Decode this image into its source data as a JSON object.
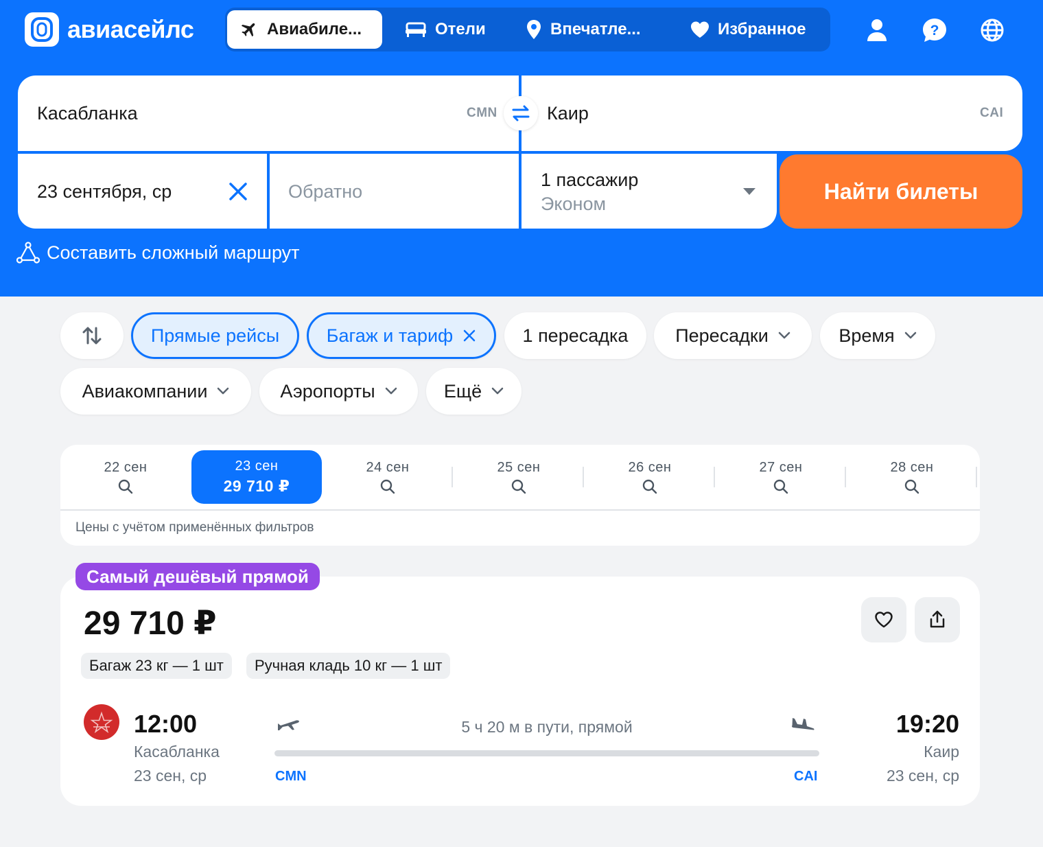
{
  "header": {
    "logo_text": "авиасейлс",
    "tabs": [
      {
        "label": "Авиабиле...",
        "icon": "plane-icon",
        "active": true
      },
      {
        "label": "Отели",
        "icon": "bed-icon",
        "active": false
      },
      {
        "label": "Впечатле...",
        "icon": "location-pin-icon",
        "active": false
      },
      {
        "label": "Избранное",
        "icon": "heart-icon",
        "active": false
      }
    ],
    "actions": [
      "user-icon",
      "help-icon",
      "globe-icon"
    ]
  },
  "search": {
    "origin": "Касабланка",
    "origin_code": "CMN",
    "destination": "Каир",
    "destination_code": "CAI",
    "depart_date": "23 сентября, ср",
    "return_placeholder": "Обратно",
    "passengers": "1 пассажир",
    "cabin_class": "Эконом",
    "search_button": "Найти билеты",
    "complex_route": "Составить сложный маршрут"
  },
  "filters": {
    "chips": [
      {
        "label": "Прямые рейсы",
        "selected": true
      },
      {
        "label": "Багаж и тариф",
        "selected": true,
        "removable": true
      },
      {
        "label": "1 пересадка",
        "selected": false
      },
      {
        "label": "Пересадки",
        "selected": false,
        "dropdown": true
      },
      {
        "label": "Время",
        "selected": false,
        "dropdown": true
      },
      {
        "label": "Авиакомпании",
        "selected": false,
        "dropdown": true
      },
      {
        "label": "Аэропорты",
        "selected": false,
        "dropdown": true
      },
      {
        "label": "Ещё",
        "selected": false,
        "dropdown": true
      }
    ]
  },
  "dates": {
    "days": [
      {
        "label": "22 сен",
        "price": null
      },
      {
        "label": "23 сен",
        "price": "29 710 ₽",
        "selected": true
      },
      {
        "label": "24 сен",
        "price": null
      },
      {
        "label": "25 сен",
        "price": null
      },
      {
        "label": "26 сен",
        "price": null
      },
      {
        "label": "27 сен",
        "price": null
      },
      {
        "label": "28 сен",
        "price": null
      }
    ],
    "note": "Цены с учётом применённых фильтров"
  },
  "ticket": {
    "badge": "Самый дешёвый прямой",
    "price": "29 710 ₽",
    "baggage": "Багаж 23 кг — 1 шт",
    "hand_luggage": "Ручная кладь 10 кг — 1 шт",
    "depart_time": "12:00",
    "depart_city": "Касабланка",
    "depart_date": "23 сен, ср",
    "arrive_time": "19:20",
    "arrive_city": "Каир",
    "arrive_date": "23 сен, ср",
    "duration": "5 ч 20 м в пути, прямой",
    "origin_code": "CMN",
    "destination_code": "CAI"
  },
  "colors": {
    "brand_blue": "#0c73fe",
    "search_orange": "#ff7a2f",
    "badge_purple": "#9549e5",
    "airline_red": "#d22b2b"
  }
}
